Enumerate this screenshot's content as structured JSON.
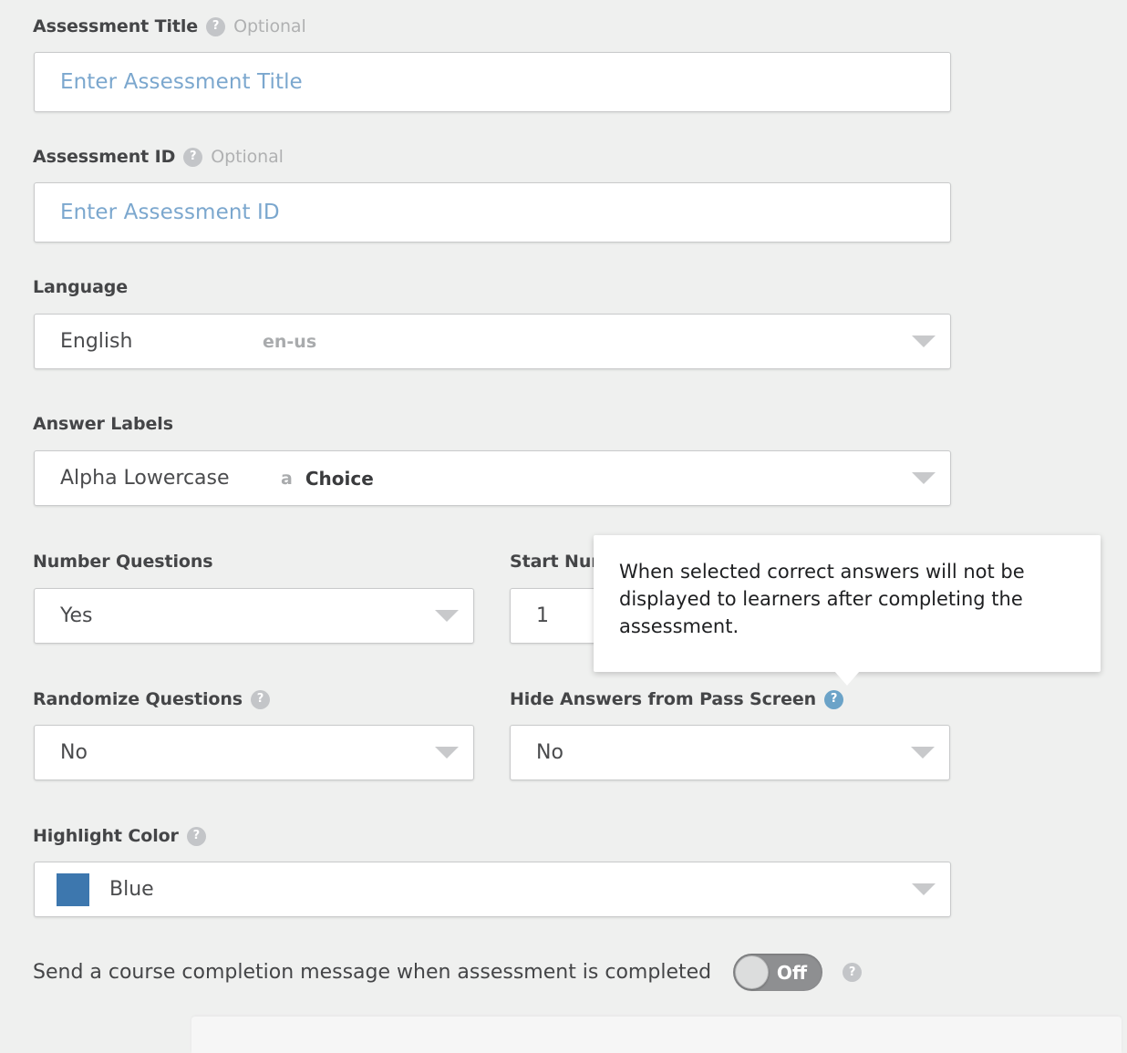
{
  "form": {
    "assessment_title": {
      "label": "Assessment Title",
      "optional": "Optional",
      "placeholder": "Enter Assessment Title",
      "value": ""
    },
    "assessment_id": {
      "label": "Assessment ID",
      "optional": "Optional",
      "placeholder": "Enter Assessment ID",
      "value": ""
    },
    "language": {
      "label": "Language",
      "value": "English",
      "code": "en-us"
    },
    "answer_labels": {
      "label": "Answer Labels",
      "value": "Alpha Lowercase",
      "sample_letter": "a",
      "sample_word": "Choice"
    },
    "number_questions": {
      "label": "Number Questions",
      "value": "Yes"
    },
    "start_number": {
      "label": "Start Number",
      "label_visible": "Start Nu",
      "value": "1"
    },
    "randomize_questions": {
      "label": "Randomize Questions",
      "value": "No"
    },
    "hide_answers": {
      "label": "Hide Answers from Pass Screen",
      "value": "No"
    },
    "highlight_color": {
      "label": "Highlight Color",
      "value": "Blue",
      "swatch_hex": "#3d77ae"
    },
    "completion_message": {
      "label": "Send a course completion message when assessment is completed",
      "toggle_state": "Off"
    }
  },
  "tooltip": {
    "text": "When selected correct answers will not be displayed to learners after completing the assessment."
  },
  "icons": {
    "help": "?",
    "caret": "chevron-down-icon"
  },
  "colors": {
    "background": "#eff0ef",
    "help_icon": "#c3c5c8",
    "help_icon_active": "#6ba3c8",
    "placeholder_text": "#7ba7ce",
    "label_text": "#444547",
    "highlight_blue": "#3d77ae",
    "toggle_off": "#8e8f91"
  }
}
